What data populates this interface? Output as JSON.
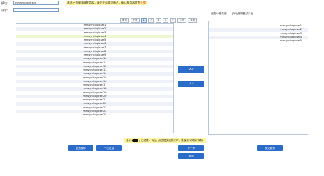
{
  "search": {
    "label1": "模块:",
    "value1": "mmsyncloglcser",
    "label2": "请求:"
  },
  "notice": {
    "text": "若选不到模块或服务器，请先在运维负责人，确认服务器状态",
    "emphasis": "正常"
  },
  "pager": {
    "first": "首页",
    "prev": "上页",
    "pages": [
      "1",
      "2",
      "3",
      "4",
      "5"
    ],
    "next": "下页",
    "last": "末页"
  },
  "left_list": [
    "mmsyncloglcser1",
    "mmsyncloglcser2",
    "mmsyncloglcser3",
    "mmsyncloglcser4",
    "mmsyncloglcser5",
    "mmsyncloglcser6",
    "mmsyncloglcser7",
    "mmsyncloglcser8",
    "mmsyncloglcser9",
    "mmsyncloglcser10",
    "mmsyncloglcser11",
    "mmsyncloglcser12",
    "mmsyncloglcser13",
    "mmsyncloglcser14",
    "mmsyncloglcser15",
    "mmsyncloglcser16",
    "mmsyncloglcser17",
    "mmsyncloglcser18",
    "mmsyncloglcser19",
    "mmsyncloglcser20",
    "mmsyncloglcser21",
    "mmsyncloglcser22",
    "mmsyncloglcser23",
    "mmsyncloglcser24",
    "mmsyncloglcser25"
  ],
  "right_header": {
    "label": "已选10服务器",
    "link": "[对比服务器]共5台"
  },
  "right_list": [
    "mmsyncloglcser1",
    "mmsyncloglcser2",
    "mmsyncloglcser3",
    "mmsyncloglcser4",
    "mmsyncloglcser5"
  ],
  "move": {
    "add": ">>",
    "remove": "<<"
  },
  "buttons": {
    "select_all": "全选操作",
    "invert": "一次反选",
    "next_step": "下一步",
    "back": "返回",
    "submit": "提交服务"
  },
  "status": {
    "prefix": "总计:",
    "middle": "；已选数：7台",
    "suffix": "；点击提交后执行时，批量共1次执行确认"
  },
  "colors": {
    "accent": "#2b6cc9",
    "highlight": "#fff59d",
    "selected_row": "#eef8cf",
    "alt_row": "#eef2f8",
    "emphasis": "#d32f2f"
  }
}
